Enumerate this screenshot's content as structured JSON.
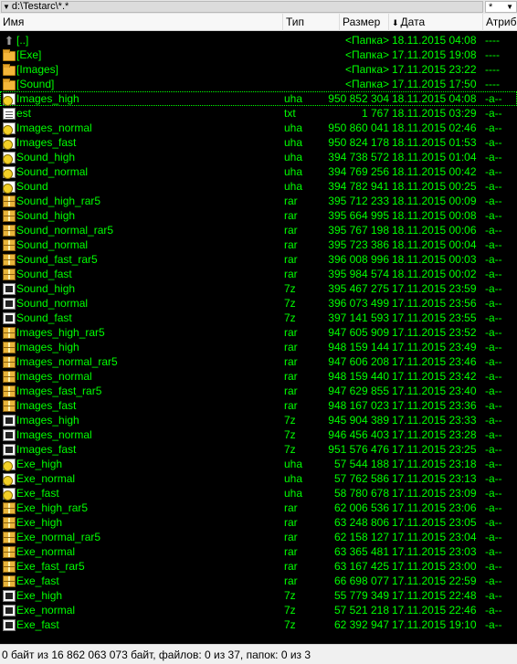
{
  "path": {
    "text": "d:\\Testarc\\*.*",
    "filter": "*"
  },
  "columns": {
    "name": "Имя",
    "type": "Тип",
    "size": "Размер",
    "date": "Дата",
    "attr": "Атриб"
  },
  "colors": {
    "list_bg": "#000000",
    "list_fg": "#00ff00"
  },
  "rows": [
    {
      "icon": "up-icon",
      "name": "[..]",
      "type": "",
      "size": "<Папка>",
      "date": "18.11.2015 04:08",
      "attr": "----"
    },
    {
      "icon": "folder-icon",
      "name": "[Exe]",
      "type": "",
      "size": "<Папка>",
      "date": "17.11.2015 19:08",
      "attr": "----"
    },
    {
      "icon": "folder-icon",
      "name": "[Images]",
      "type": "",
      "size": "<Папка>",
      "date": "17.11.2015 23:22",
      "attr": "----"
    },
    {
      "icon": "folder-icon",
      "name": "[Sound]",
      "type": "",
      "size": "<Папка>",
      "date": "17.11.2015 17:50",
      "attr": "----"
    },
    {
      "icon": "uha-file-icon",
      "name": "Images_high",
      "type": "uha",
      "size": "950 852 304",
      "date": "18.11.2015 04:08",
      "attr": "-a--"
    },
    {
      "icon": "text-file-icon",
      "name": "est",
      "type": "txt",
      "size": "1 767",
      "date": "18.11.2015 03:29",
      "attr": "-a--"
    },
    {
      "icon": "uha-file-icon",
      "name": "Images_normal",
      "type": "uha",
      "size": "950 860 041",
      "date": "18.11.2015 02:46",
      "attr": "-a--"
    },
    {
      "icon": "uha-file-icon",
      "name": "Images_fast",
      "type": "uha",
      "size": "950 824 178",
      "date": "18.11.2015 01:53",
      "attr": "-a--"
    },
    {
      "icon": "uha-file-icon",
      "name": "Sound_high",
      "type": "uha",
      "size": "394 738 572",
      "date": "18.11.2015 01:04",
      "attr": "-a--"
    },
    {
      "icon": "uha-file-icon",
      "name": "Sound_normal",
      "type": "uha",
      "size": "394 769 256",
      "date": "18.11.2015 00:42",
      "attr": "-a--"
    },
    {
      "icon": "uha-file-icon",
      "name": "Sound",
      "type": "uha",
      "size": "394 782 941",
      "date": "18.11.2015 00:25",
      "attr": "-a--"
    },
    {
      "icon": "rar-file-icon",
      "name": "Sound_high_rar5",
      "type": "rar",
      "size": "395 712 233",
      "date": "18.11.2015 00:09",
      "attr": "-a--"
    },
    {
      "icon": "rar-file-icon",
      "name": "Sound_high",
      "type": "rar",
      "size": "395 664 995",
      "date": "18.11.2015 00:08",
      "attr": "-a--"
    },
    {
      "icon": "rar-file-icon",
      "name": "Sound_normal_rar5",
      "type": "rar",
      "size": "395 767 198",
      "date": "18.11.2015 00:06",
      "attr": "-a--"
    },
    {
      "icon": "rar-file-icon",
      "name": "Sound_normal",
      "type": "rar",
      "size": "395 723 386",
      "date": "18.11.2015 00:04",
      "attr": "-a--"
    },
    {
      "icon": "rar-file-icon",
      "name": "Sound_fast_rar5",
      "type": "rar",
      "size": "396 008 996",
      "date": "18.11.2015 00:03",
      "attr": "-a--"
    },
    {
      "icon": "rar-file-icon",
      "name": "Sound_fast",
      "type": "rar",
      "size": "395 984 574",
      "date": "18.11.2015 00:02",
      "attr": "-a--"
    },
    {
      "icon": "7z-file-icon",
      "name": "Sound_high",
      "type": "7z",
      "size": "395 467 275",
      "date": "17.11.2015 23:59",
      "attr": "-a--"
    },
    {
      "icon": "7z-file-icon",
      "name": "Sound_normal",
      "type": "7z",
      "size": "396 073 499",
      "date": "17.11.2015 23:56",
      "attr": "-a--"
    },
    {
      "icon": "7z-file-icon",
      "name": "Sound_fast",
      "type": "7z",
      "size": "397 141 593",
      "date": "17.11.2015 23:55",
      "attr": "-a--"
    },
    {
      "icon": "rar-file-icon",
      "name": "Images_high_rar5",
      "type": "rar",
      "size": "947 605 909",
      "date": "17.11.2015 23:52",
      "attr": "-a--"
    },
    {
      "icon": "rar-file-icon",
      "name": "Images_high",
      "type": "rar",
      "size": "948 159 144",
      "date": "17.11.2015 23:49",
      "attr": "-a--"
    },
    {
      "icon": "rar-file-icon",
      "name": "Images_normal_rar5",
      "type": "rar",
      "size": "947 606 208",
      "date": "17.11.2015 23:46",
      "attr": "-a--"
    },
    {
      "icon": "rar-file-icon",
      "name": "Images_normal",
      "type": "rar",
      "size": "948 159 440",
      "date": "17.11.2015 23:42",
      "attr": "-a--"
    },
    {
      "icon": "rar-file-icon",
      "name": "Images_fast_rar5",
      "type": "rar",
      "size": "947 629 855",
      "date": "17.11.2015 23:40",
      "attr": "-a--"
    },
    {
      "icon": "rar-file-icon",
      "name": "Images_fast",
      "type": "rar",
      "size": "948 167 023",
      "date": "17.11.2015 23:36",
      "attr": "-a--"
    },
    {
      "icon": "7z-file-icon",
      "name": "Images_high",
      "type": "7z",
      "size": "945 904 389",
      "date": "17.11.2015 23:33",
      "attr": "-a--"
    },
    {
      "icon": "7z-file-icon",
      "name": "Images_normal",
      "type": "7z",
      "size": "946 456 403",
      "date": "17.11.2015 23:28",
      "attr": "-a--"
    },
    {
      "icon": "7z-file-icon",
      "name": "Images_fast",
      "type": "7z",
      "size": "951 576 476",
      "date": "17.11.2015 23:25",
      "attr": "-a--"
    },
    {
      "icon": "uha-file-icon",
      "name": "Exe_high",
      "type": "uha",
      "size": "57 544 188",
      "date": "17.11.2015 23:18",
      "attr": "-a--"
    },
    {
      "icon": "uha-file-icon",
      "name": "Exe_normal",
      "type": "uha",
      "size": "57 762 586",
      "date": "17.11.2015 23:13",
      "attr": "-a--"
    },
    {
      "icon": "uha-file-icon",
      "name": "Exe_fast",
      "type": "uha",
      "size": "58 780 678",
      "date": "17.11.2015 23:09",
      "attr": "-a--"
    },
    {
      "icon": "rar-file-icon",
      "name": "Exe_high_rar5",
      "type": "rar",
      "size": "62 006 536",
      "date": "17.11.2015 23:06",
      "attr": "-a--"
    },
    {
      "icon": "rar-file-icon",
      "name": "Exe_high",
      "type": "rar",
      "size": "63 248 806",
      "date": "17.11.2015 23:05",
      "attr": "-a--"
    },
    {
      "icon": "rar-file-icon",
      "name": "Exe_normal_rar5",
      "type": "rar",
      "size": "62 158 127",
      "date": "17.11.2015 23:04",
      "attr": "-a--"
    },
    {
      "icon": "rar-file-icon",
      "name": "Exe_normal",
      "type": "rar",
      "size": "63 365 481",
      "date": "17.11.2015 23:03",
      "attr": "-a--"
    },
    {
      "icon": "rar-file-icon",
      "name": "Exe_fast_rar5",
      "type": "rar",
      "size": "63 167 425",
      "date": "17.11.2015 23:00",
      "attr": "-a--"
    },
    {
      "icon": "rar-file-icon",
      "name": "Exe_fast",
      "type": "rar",
      "size": "66 698 077",
      "date": "17.11.2015 22:59",
      "attr": "-a--"
    },
    {
      "icon": "7z-file-icon",
      "name": "Exe_high",
      "type": "7z",
      "size": "55 779 349",
      "date": "17.11.2015 22:48",
      "attr": "-a--"
    },
    {
      "icon": "7z-file-icon",
      "name": "Exe_normal",
      "type": "7z",
      "size": "57 521 218",
      "date": "17.11.2015 22:46",
      "attr": "-a--"
    },
    {
      "icon": "7z-file-icon",
      "name": "Exe_fast",
      "type": "7z",
      "size": "62 392 947",
      "date": "17.11.2015 19:10",
      "attr": "-a--"
    }
  ],
  "status": "0 байт из 16 862 063 073 байт, файлов: 0 из 37, папок: 0 из 3"
}
